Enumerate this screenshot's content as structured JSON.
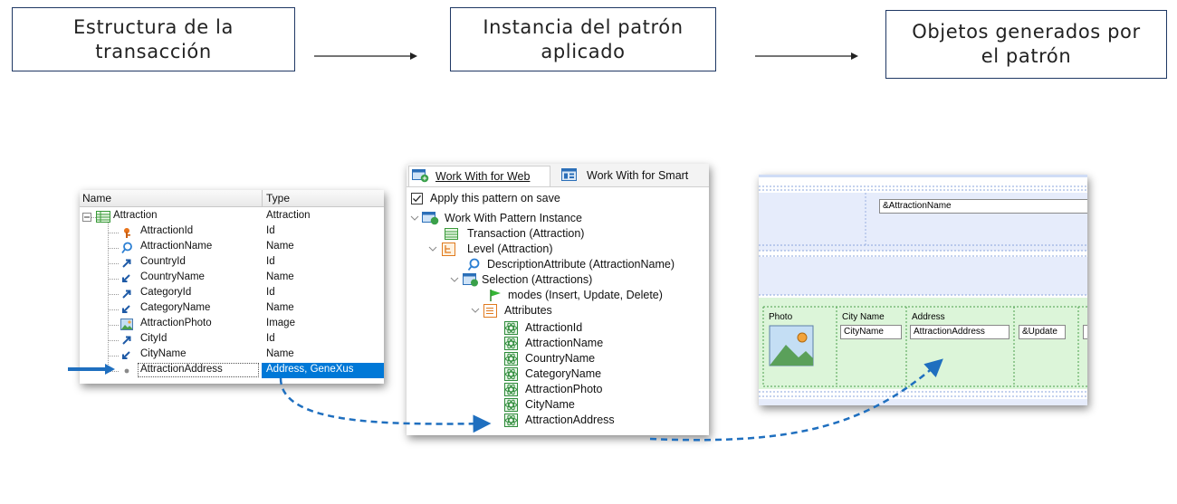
{
  "header": {
    "box1": {
      "line1": "Estructura de la",
      "line2": "transacción"
    },
    "box2": {
      "line1": "Instancia del patrón",
      "line2": "aplicado"
    },
    "box3": {
      "line1": "Objetos generados por",
      "line2": "el patrón"
    }
  },
  "transaction": {
    "col_name": "Name",
    "col_type": "Type",
    "root": {
      "name": "Attraction",
      "type": "Attraction",
      "icon": "transaction-icon"
    },
    "attributes": [
      {
        "name": "AttractionId",
        "type": "Id",
        "icon": "key-icon"
      },
      {
        "name": "AttractionName",
        "type": "Name",
        "icon": "description-icon"
      },
      {
        "name": "CountryId",
        "type": "Id",
        "icon": "foreign-key-icon"
      },
      {
        "name": "CountryName",
        "type": "Name",
        "icon": "inferred-icon"
      },
      {
        "name": "CategoryId",
        "type": "Id",
        "icon": "foreign-key-icon"
      },
      {
        "name": "CategoryName",
        "type": "Name",
        "icon": "inferred-icon"
      },
      {
        "name": "AttractionPhoto",
        "type": "Image",
        "icon": "image-icon"
      },
      {
        "name": "CityId",
        "type": "Id",
        "icon": "foreign-key-icon"
      },
      {
        "name": "CityName",
        "type": "Name",
        "icon": "inferred-icon"
      },
      {
        "name": "AttractionAddress",
        "type": "Address, GeneXus",
        "icon": "dot-icon",
        "selected": true
      }
    ]
  },
  "pattern": {
    "tabs": [
      "Work With for Web",
      "Work With for Smart"
    ],
    "apply_label": "Apply this pattern on save",
    "apply_checked": true,
    "instance": "Work With Pattern Instance",
    "transaction": "Transaction (Attraction)",
    "level": "Level (Attraction)",
    "description_attribute": "DescriptionAttribute (AttractionName)",
    "selection": "Selection (Attractions)",
    "modes": "modes (Insert, Update, Delete)",
    "attributes_label": "Attributes",
    "attributes": [
      "AttractionId",
      "AttractionName",
      "CountryName",
      "CategoryName",
      "AttractionPhoto",
      "CityName",
      "AttractionAddress"
    ]
  },
  "form": {
    "name_field": "&AttractionName",
    "columns": [
      {
        "header": "Photo",
        "value": ""
      },
      {
        "header": "City Name",
        "value": "CityName"
      },
      {
        "header": "Address",
        "value": "AttractionAddress"
      },
      {
        "header": "",
        "value": "&Update"
      }
    ]
  },
  "colors": {
    "accent_blue": "#1f6fbf",
    "box_border": "#1f3864",
    "form_band": "#e6ecfb",
    "grid_band": "#dcf5d9",
    "selection": "#0078d7"
  }
}
